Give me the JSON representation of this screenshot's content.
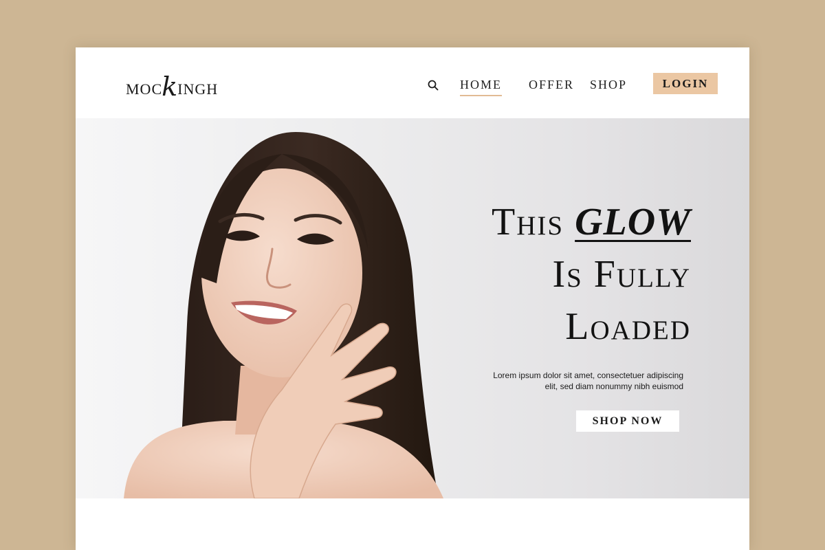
{
  "brand": {
    "logo_before": "MOC",
    "logo_swash": "k",
    "logo_after": "INGH"
  },
  "icons": {
    "search": "search-icon"
  },
  "nav": {
    "home": "HOME",
    "offer": "OFFER",
    "shop": "SHOP",
    "login": "LOGIN",
    "active": "HOME"
  },
  "hero": {
    "headline_line1_plain": "This ",
    "headline_line1_accent": "GLOW",
    "headline_line2": "Is Fully",
    "headline_line3": "Loaded",
    "description_line1": "Lorem ipsum dolor sit amet, consectetuer adipiscing",
    "description_line2": "elit, sed diam nonummy nibh euismod",
    "cta": "SHOP NOW"
  },
  "colors": {
    "page_background": "#cdb694",
    "accent": "#ebc7a3",
    "nav_underline": "#e2bb94",
    "text": "#121212"
  }
}
